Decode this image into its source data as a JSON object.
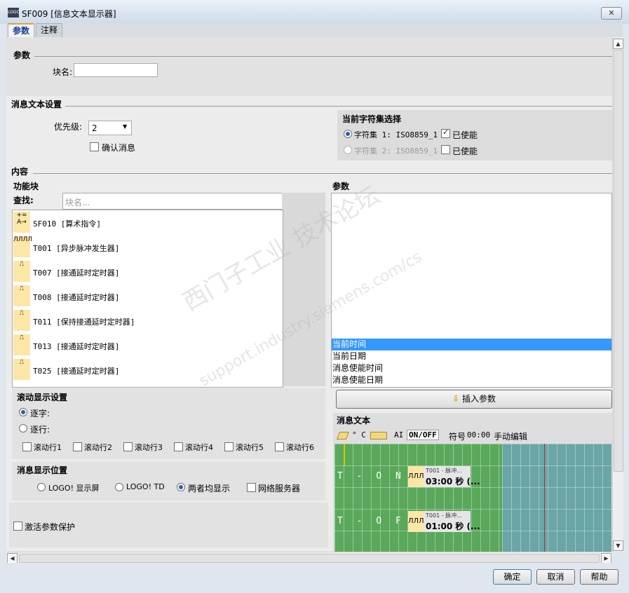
{
  "window": {
    "title": "SF009 [信息文本显示器]",
    "close": "✕",
    "icon_text": "LOGO"
  },
  "tabs": [
    {
      "label": "参数"
    },
    {
      "label": "注释"
    }
  ],
  "params_section": {
    "title": "参数",
    "block_name_label": "块名:",
    "block_name_value": ""
  },
  "msg_settings": {
    "title": "消息文本设置",
    "priority_label": "优先级:",
    "priority_value": "2",
    "ack_label": "确认消息"
  },
  "charset": {
    "title": "当前字符集选择",
    "set1": "字符集 1: ISO8859_1",
    "set2": "字符集 2: ISO8859_1",
    "enabled1": "已使能",
    "enabled2": "已使能"
  },
  "content": {
    "title": "内容",
    "fb_title": "功能块",
    "search_label": "查找:",
    "search_placeholder": "块名...",
    "blocks": [
      {
        "icon": "+= A→",
        "label": "SF010 [算术指令]"
      },
      {
        "icon": "ЛЛЛЛ",
        "label": "T001 [异步脉冲发生器]"
      },
      {
        "icon": "⎍",
        "label": "T007 [接通延时定时器]"
      },
      {
        "icon": "⎍",
        "label": "T008 [接通延时定时器]"
      },
      {
        "icon": "⎍",
        "label": "T011 [保持接通延时定时器]"
      },
      {
        "icon": "⎍",
        "label": "T013 [接通延时定时器]"
      },
      {
        "icon": "⎍",
        "label": "T025 [接通延时定时器]"
      }
    ],
    "param_title": "参数",
    "param_items": [
      "当前时间",
      "当前日期",
      "消息使能时间",
      "消息使能日期"
    ],
    "insert_button": "插入参数"
  },
  "scroll_settings": {
    "title": "滚动显示设置",
    "by_char": "逐字:",
    "by_line": "逐行:",
    "lines": [
      "滚动行1",
      "滚动行2",
      "滚动行3",
      "滚动行4",
      "滚动行5",
      "滚动行6"
    ]
  },
  "display_pos": {
    "title": "消息显示位置",
    "opt1": "LOGO! 显示屏",
    "opt2": "LOGO! TD",
    "opt3": "两者均显示",
    "opt4": "网络服务器"
  },
  "protect": {
    "label": "激活参数保护"
  },
  "message_text": {
    "title": "消息文本",
    "toolbar": {
      "deg": "° C",
      "ai": "AI",
      "onoff": "ON/OFF",
      "symbol": "符号",
      "time": "00:00",
      "edit": "手动编辑"
    },
    "rows": [
      {
        "label": "T - O N",
        "block_top": "T001 - 脉冲...",
        "block_main": "03:00 秒 (..."
      },
      {
        "label": "T - O F F",
        "block_top": "T001 - 脉冲...",
        "block_main": "01:00 秒 (..."
      }
    ]
  },
  "buttons": {
    "ok": "确定",
    "cancel": "取消",
    "help": "帮助"
  },
  "watermark": {
    "line1": "西门子工业  技术论坛",
    "line2": "support.industry.siemens.com/cs"
  }
}
